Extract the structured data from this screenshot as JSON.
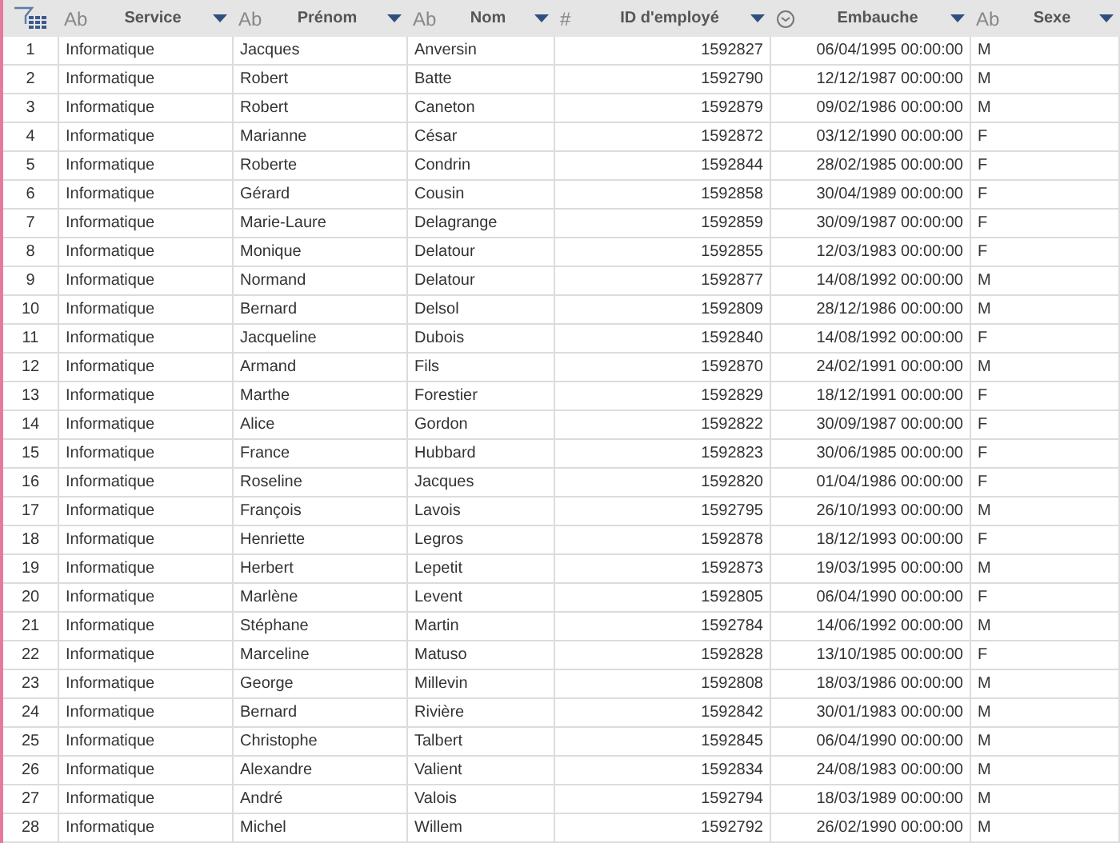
{
  "table": {
    "columns": [
      {
        "label": "Service",
        "kind": "text",
        "type_label": "Ab"
      },
      {
        "label": "Prénom",
        "kind": "text",
        "type_label": "Ab"
      },
      {
        "label": "Nom",
        "kind": "text",
        "type_label": "Ab"
      },
      {
        "label": "ID d'employé",
        "kind": "number",
        "type_label": "#"
      },
      {
        "label": "Embauche",
        "kind": "date"
      },
      {
        "label": "Sexe",
        "kind": "text",
        "type_label": "Ab"
      }
    ],
    "rows": [
      {
        "row_number": "1",
        "cells": [
          "Informatique",
          "Jacques",
          "Anversin",
          "1592827",
          "06/04/1995 00:00:00",
          "M"
        ]
      },
      {
        "row_number": "2",
        "cells": [
          "Informatique",
          "Robert",
          "Batte",
          "1592790",
          "12/12/1987 00:00:00",
          "M"
        ]
      },
      {
        "row_number": "3",
        "cells": [
          "Informatique",
          "Robert",
          "Caneton",
          "1592879",
          "09/02/1986 00:00:00",
          "M"
        ]
      },
      {
        "row_number": "4",
        "cells": [
          "Informatique",
          "Marianne",
          "César",
          "1592872",
          "03/12/1990 00:00:00",
          "F"
        ]
      },
      {
        "row_number": "5",
        "cells": [
          "Informatique",
          "Roberte",
          "Condrin",
          "1592844",
          "28/02/1985 00:00:00",
          "F"
        ]
      },
      {
        "row_number": "6",
        "cells": [
          "Informatique",
          "Gérard",
          "Cousin",
          "1592858",
          "30/04/1989 00:00:00",
          "F"
        ]
      },
      {
        "row_number": "7",
        "cells": [
          "Informatique",
          "Marie-Laure",
          "Delagrange",
          "1592859",
          "30/09/1987 00:00:00",
          "F"
        ]
      },
      {
        "row_number": "8",
        "cells": [
          "Informatique",
          "Monique",
          "Delatour",
          "1592855",
          "12/03/1983 00:00:00",
          "F"
        ]
      },
      {
        "row_number": "9",
        "cells": [
          "Informatique",
          "Normand",
          "Delatour",
          "1592877",
          "14/08/1992 00:00:00",
          "M"
        ]
      },
      {
        "row_number": "10",
        "cells": [
          "Informatique",
          "Bernard",
          "Delsol",
          "1592809",
          "28/12/1986 00:00:00",
          "M"
        ]
      },
      {
        "row_number": "11",
        "cells": [
          "Informatique",
          "Jacqueline",
          "Dubois",
          "1592840",
          "14/08/1992 00:00:00",
          "F"
        ]
      },
      {
        "row_number": "12",
        "cells": [
          "Informatique",
          "Armand",
          "Fils",
          "1592870",
          "24/02/1991 00:00:00",
          "M"
        ]
      },
      {
        "row_number": "13",
        "cells": [
          "Informatique",
          "Marthe",
          "Forestier",
          "1592829",
          "18/12/1991 00:00:00",
          "F"
        ]
      },
      {
        "row_number": "14",
        "cells": [
          "Informatique",
          "Alice",
          "Gordon",
          "1592822",
          "30/09/1987 00:00:00",
          "F"
        ]
      },
      {
        "row_number": "15",
        "cells": [
          "Informatique",
          "France",
          "Hubbard",
          "1592823",
          "30/06/1985 00:00:00",
          "F"
        ]
      },
      {
        "row_number": "16",
        "cells": [
          "Informatique",
          "Roseline",
          "Jacques",
          "1592820",
          "01/04/1986 00:00:00",
          "F"
        ]
      },
      {
        "row_number": "17",
        "cells": [
          "Informatique",
          "François",
          "Lavois",
          "1592795",
          "26/10/1993 00:00:00",
          "M"
        ]
      },
      {
        "row_number": "18",
        "cells": [
          "Informatique",
          "Henriette",
          "Legros",
          "1592878",
          "18/12/1993 00:00:00",
          "F"
        ]
      },
      {
        "row_number": "19",
        "cells": [
          "Informatique",
          "Herbert",
          "Lepetit",
          "1592873",
          "19/03/1995 00:00:00",
          "M"
        ]
      },
      {
        "row_number": "20",
        "cells": [
          "Informatique",
          "Marlène",
          "Levent",
          "1592805",
          "06/04/1990 00:00:00",
          "F"
        ]
      },
      {
        "row_number": "21",
        "cells": [
          "Informatique",
          "Stéphane",
          "Martin",
          "1592784",
          "14/06/1992 00:00:00",
          "M"
        ]
      },
      {
        "row_number": "22",
        "cells": [
          "Informatique",
          "Marceline",
          "Matuso",
          "1592828",
          "13/10/1985 00:00:00",
          "F"
        ]
      },
      {
        "row_number": "23",
        "cells": [
          "Informatique",
          "George",
          "Millevin",
          "1592808",
          "18/03/1986 00:00:00",
          "M"
        ]
      },
      {
        "row_number": "24",
        "cells": [
          "Informatique",
          "Bernard",
          "Rivière",
          "1592842",
          "30/01/1983 00:00:00",
          "M"
        ]
      },
      {
        "row_number": "25",
        "cells": [
          "Informatique",
          "Christophe",
          "Talbert",
          "1592845",
          "06/04/1990 00:00:00",
          "M"
        ]
      },
      {
        "row_number": "26",
        "cells": [
          "Informatique",
          "Alexandre",
          "Valient",
          "1592834",
          "24/08/1983 00:00:00",
          "M"
        ]
      },
      {
        "row_number": "27",
        "cells": [
          "Informatique",
          "André",
          "Valois",
          "1592794",
          "18/03/1989 00:00:00",
          "M"
        ]
      },
      {
        "row_number": "28",
        "cells": [
          "Informatique",
          "Michel",
          "Willem",
          "1592792",
          "26/02/1990 00:00:00",
          "M"
        ]
      }
    ]
  }
}
